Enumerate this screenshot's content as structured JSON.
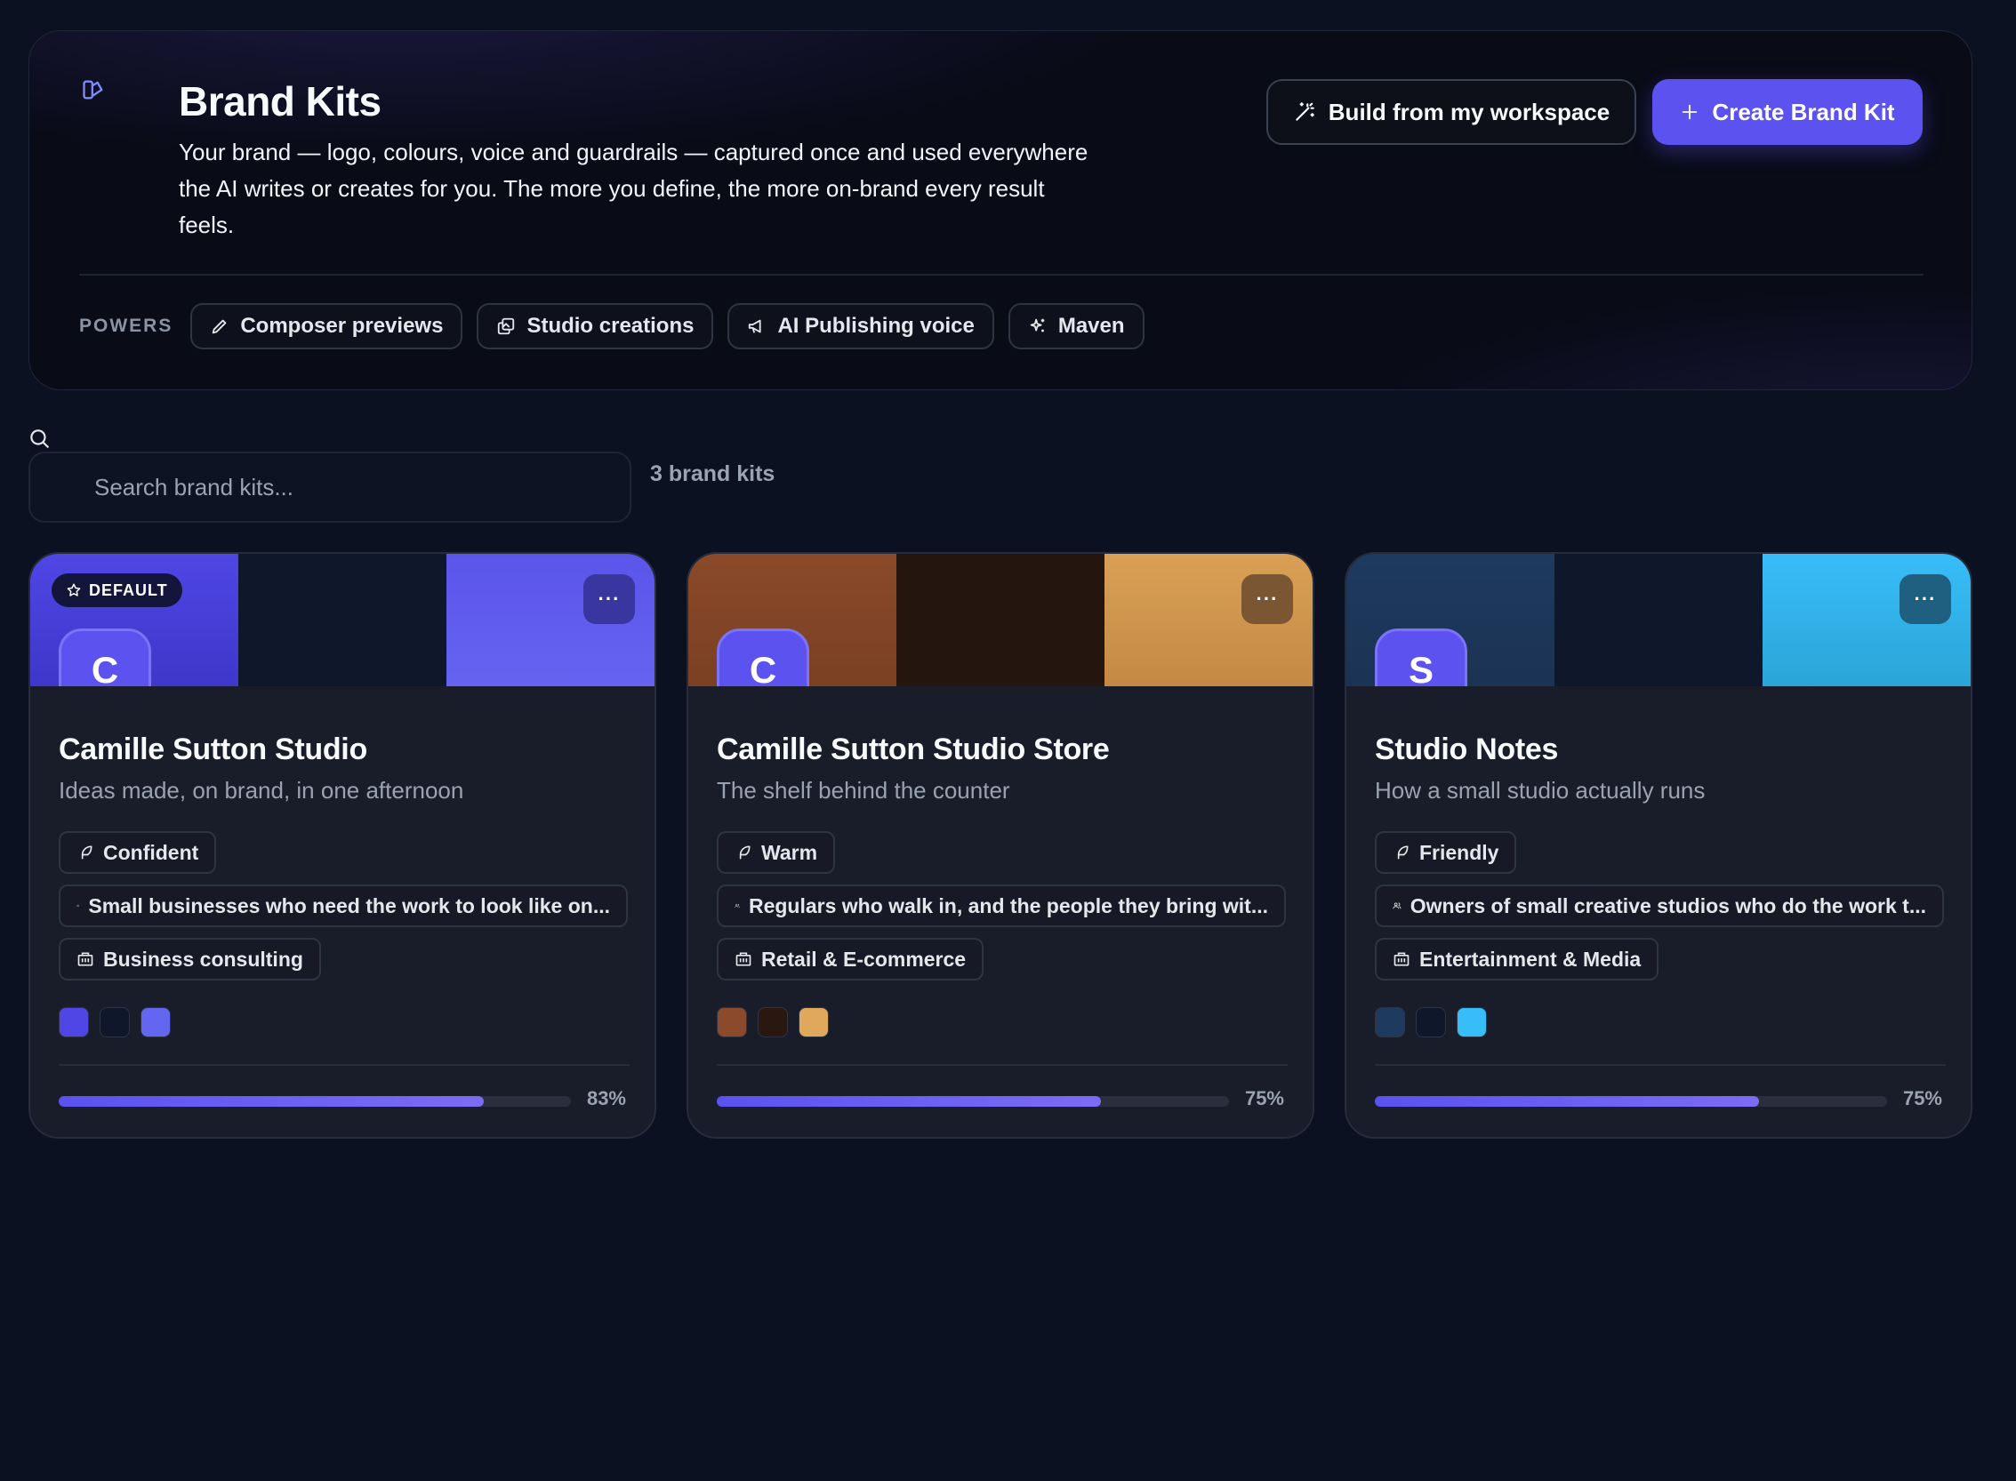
{
  "header": {
    "title": "Brand Kits",
    "description": "Your brand — logo, colours, voice and guardrails — captured once and used everywhere the AI writes or creates for you. The more you define, the more on-brand every result feels.",
    "build_button": "Build from my workspace",
    "create_button": "Create Brand Kit"
  },
  "powers": {
    "label": "POWERS",
    "items": [
      {
        "label": "Composer previews",
        "icon": "pencil-icon"
      },
      {
        "label": "Studio creations",
        "icon": "images-icon"
      },
      {
        "label": "AI Publishing voice",
        "icon": "megaphone-icon"
      },
      {
        "label": "Maven",
        "icon": "sparkles-icon"
      }
    ]
  },
  "search": {
    "placeholder": "Search brand kits...",
    "value": ""
  },
  "count_label": "3 brand kits",
  "default_badge": "DEFAULT",
  "menu_label": "···",
  "cards": [
    {
      "initial": "C",
      "name": "Camille Sutton Studio",
      "tagline": "Ideas made, on brand, in one afternoon",
      "tone": "Confident",
      "audience": "Small businesses who need the work to look like on...",
      "industry": "Business consulting",
      "colors": [
        "#4f46e5",
        "#0f172a",
        "#6366f1"
      ],
      "completeness": 83,
      "completeness_label": "83%",
      "is_default": true
    },
    {
      "initial": "C",
      "name": "Camille Sutton Studio Store",
      "tagline": "The shelf behind the counter",
      "tone": "Warm",
      "audience": "Regulars who walk in, and the people they bring wit...",
      "industry": "Retail & E-commerce",
      "colors": [
        "#8b4a2b",
        "#2a1810",
        "#e0a85a"
      ],
      "completeness": 75,
      "completeness_label": "75%",
      "is_default": false
    },
    {
      "initial": "S",
      "name": "Studio Notes",
      "tagline": "How a small studio actually runs",
      "tone": "Friendly",
      "audience": "Owners of small creative studios who do the work t...",
      "industry": "Entertainment & Media",
      "colors": [
        "#1e3a5f",
        "#0f172a",
        "#38bdf8"
      ],
      "completeness": 75,
      "completeness_label": "75%",
      "is_default": false
    }
  ]
}
